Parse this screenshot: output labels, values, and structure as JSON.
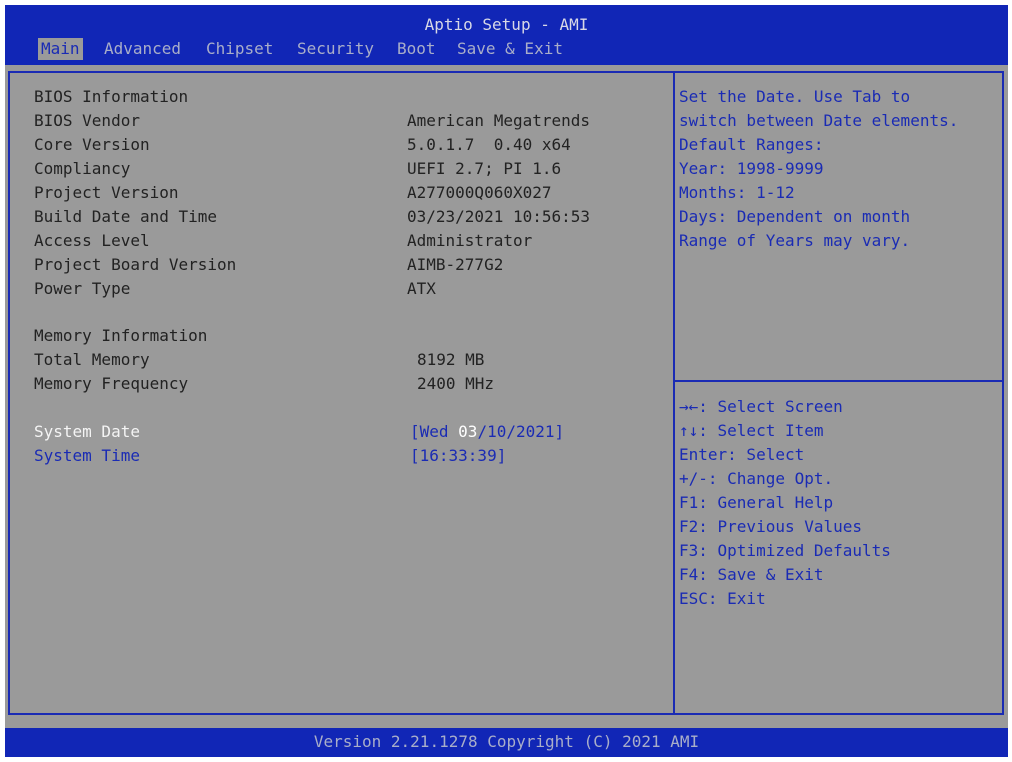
{
  "header": {
    "title": "Aptio Setup - AMI",
    "tabs": [
      "Main",
      "Advanced",
      "Chipset",
      "Security",
      "Boot",
      "Save & Exit"
    ],
    "active_tab": "Main"
  },
  "main": {
    "bios_section": "BIOS Information",
    "bios_items": [
      {
        "label": "BIOS Vendor",
        "value": "American Megatrends"
      },
      {
        "label": "Core Version",
        "value": "5.0.1.7  0.40 x64"
      },
      {
        "label": "Compliancy",
        "value": "UEFI 2.7; PI 1.6"
      },
      {
        "label": "Project Version",
        "value": "A277000Q060X027"
      },
      {
        "label": "Build Date and Time",
        "value": "03/23/2021 10:56:53"
      },
      {
        "label": "Access Level",
        "value": "Administrator"
      },
      {
        "label": "Project Board Version",
        "value": "AIMB-277G2"
      },
      {
        "label": "Power Type",
        "value": "ATX"
      }
    ],
    "memory_section": "Memory Information",
    "memory_items": [
      {
        "label": "Total Memory",
        "value": "8192 MB"
      },
      {
        "label": "Memory Frequency",
        "value": "2400 MHz"
      }
    ],
    "system_date": {
      "label": "System Date",
      "value_prefix": "[Wed ",
      "value_highlight": "03",
      "value_suffix": "/10/2021]"
    },
    "system_time": {
      "label": "System Time",
      "value": "[16:33:39]"
    }
  },
  "help_panel": {
    "description": [
      "Set the Date. Use Tab to",
      "switch between Date elements.",
      "Default Ranges:",
      "Year: 1998-9999",
      "Months: 1-12",
      "Days: Dependent on month",
      "Range of Years may vary."
    ],
    "keys": [
      "→←: Select Screen",
      "↑↓: Select Item",
      "Enter: Select",
      "+/-: Change Opt.",
      "F1: General Help",
      "F2: Previous Values",
      "F3: Optimized Defaults",
      "F4: Save & Exit",
      "ESC: Exit"
    ]
  },
  "footer": {
    "version": "Version 2.21.1278 Copyright (C) 2021 AMI"
  },
  "colors": {
    "bar_blue": "#1126b6",
    "background_gray": "#9a9a9a",
    "link_blue": "#1a2bb4",
    "selected_white": "#f4f4f4"
  }
}
